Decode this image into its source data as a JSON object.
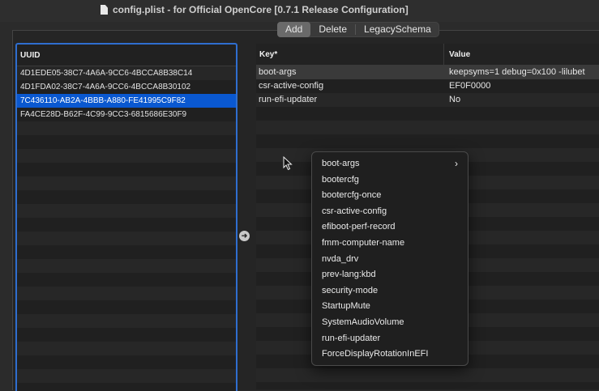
{
  "window": {
    "title": "config.plist - for Official OpenCore [0.7.1 Release Configuration]"
  },
  "toolbar": {
    "segments": [
      "Add",
      "Delete",
      "LegacySchema"
    ],
    "active": "Add"
  },
  "uuid_table": {
    "header": "UUID",
    "rows": [
      "4D1EDE05-38C7-4A6A-9CC6-4BCCA8B38C14",
      "4D1FDA02-38C7-4A6A-9CC6-4BCCA8B30102",
      "7C436110-AB2A-4BBB-A880-FE41995C9F82",
      "FA4CE28D-B62F-4C99-9CC3-6815686E30F9"
    ],
    "selected_index": 2
  },
  "kv_table": {
    "headers": {
      "key": "Key*",
      "value": "Value"
    },
    "rows": [
      {
        "key": "boot-args",
        "value": "keepsyms=1 debug=0x100 -lilubet"
      },
      {
        "key": "csr-active-config",
        "value": "EF0F0000"
      },
      {
        "key": "run-efi-updater",
        "value": "No"
      }
    ],
    "highlighted_index": 0
  },
  "context_menu": {
    "items": [
      "boot-args",
      "bootercfg",
      "bootercfg-once",
      "csr-active-config",
      "efiboot-perf-record",
      "fmm-computer-name",
      "nvda_drv",
      "prev-lang:kbd",
      "security-mode",
      "StartupMute",
      "SystemAudioVolume",
      "run-efi-updater",
      "ForceDisplayRotationInEFI"
    ],
    "submenu_item": "boot-args"
  },
  "icons": {
    "document": "document-icon",
    "move": "arrow-right-circle-icon",
    "cursor": "mouse-pointer-icon",
    "submenu": "chevron-right-icon"
  }
}
